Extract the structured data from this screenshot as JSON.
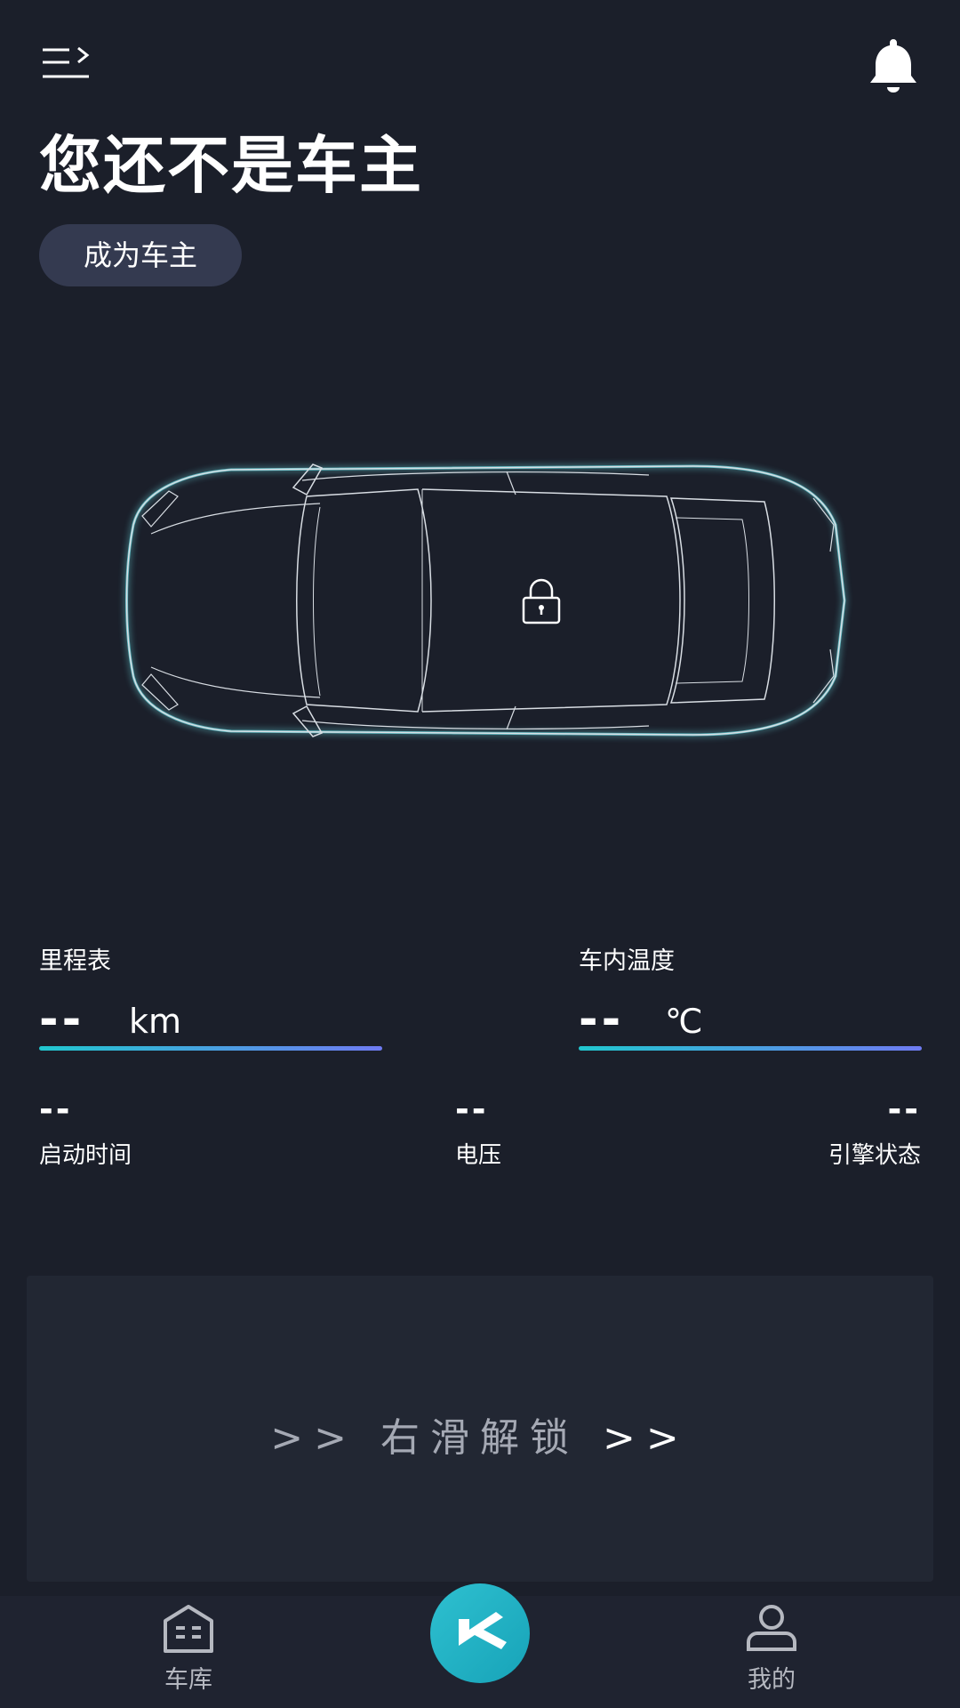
{
  "header": {
    "title": "您还不是车主",
    "become_owner_label": "成为车主",
    "icons": {
      "menu": "menu-expand-icon",
      "notifications": "bell-icon"
    }
  },
  "vehicle": {
    "image": "car-top-view",
    "lock_icon": "lock-icon"
  },
  "stats": {
    "odometer": {
      "label": "里程表",
      "value": "--",
      "unit": "km"
    },
    "cabin_temp": {
      "label": "车内温度",
      "value": "--",
      "unit": "℃"
    },
    "start_time": {
      "label": "启动时间",
      "value": "--"
    },
    "voltage": {
      "label": "电压",
      "value": "--"
    },
    "engine_status": {
      "label": "引擎状态",
      "value": "--"
    }
  },
  "unlock": {
    "prefix": ">>",
    "text": "右滑解锁",
    "suffix": ">>"
  },
  "nav": {
    "garage_label": "车库",
    "mine_label": "我的",
    "center_icon": "k-logo-icon"
  },
  "colors": {
    "background": "#1b1f2a",
    "accent_gradient_start": "#21c7cf",
    "accent_gradient_end": "#6f7bf2",
    "button_bg": "#343a50",
    "center_button": "#2ec0d0"
  }
}
